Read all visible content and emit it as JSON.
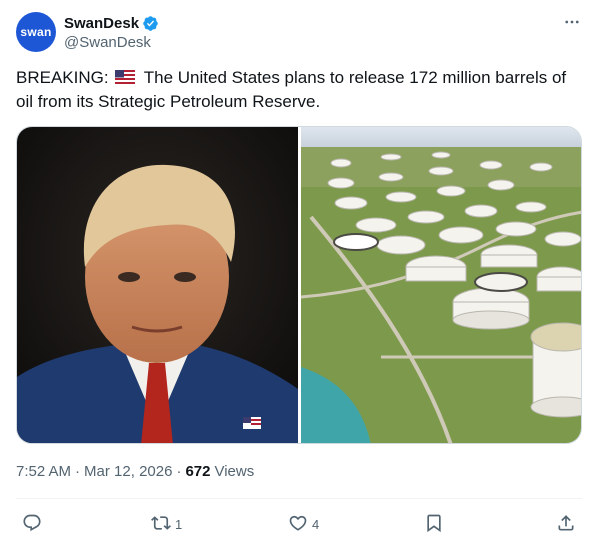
{
  "author": {
    "avatar_text": "swan",
    "display_name": "SwanDesk",
    "handle": "@SwanDesk",
    "verified": true
  },
  "tweet": {
    "prefix": "BREAKING:",
    "flag": "us-flag-icon",
    "text": "The United States plans to release 172 million barrels of oil from its Strategic Petroleum Reserve."
  },
  "meta": {
    "time": "7:52 AM",
    "date": "Mar 12, 2026",
    "views_count": "672",
    "views_label": "Views"
  },
  "actions": {
    "reply_count": "",
    "retweet_count": "1",
    "like_count": "4",
    "bookmark_count": ""
  },
  "colors": {
    "accent": "#1d9bf0",
    "text": "#0f1419",
    "secondary": "#536471",
    "avatar_bg": "#1e57d6"
  }
}
